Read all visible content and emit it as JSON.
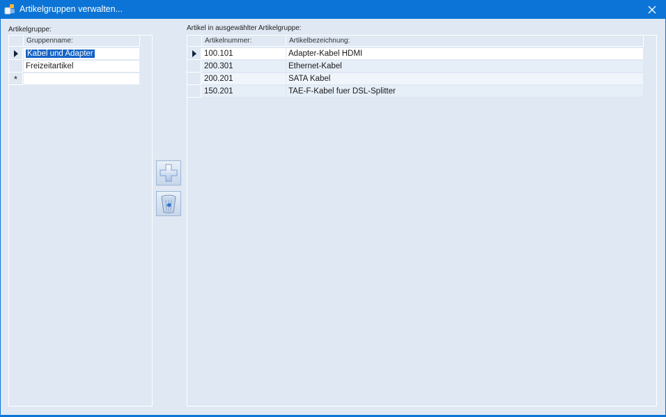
{
  "window": {
    "title": "Artikelgruppen verwalten..."
  },
  "left": {
    "label": "Artikelgruppe:",
    "column": "Gruppenname:",
    "rows": [
      "Kabel und Adapter",
      "Freizeitartikel"
    ],
    "new_row_marker": "*"
  },
  "right": {
    "label": "Artikel in ausgewählter Artikelgruppe:",
    "columns": [
      "Artikelnummer:",
      "Artikelbezeichnung:"
    ],
    "rows": [
      [
        "100.101",
        "Adapter-Kabel HDMI"
      ],
      [
        "200.301",
        "Ethernet-Kabel"
      ],
      [
        "200.201",
        "SATA Kabel"
      ],
      [
        "150.201",
        "TAE-F-Kabel fuer DSL-Splitter"
      ]
    ]
  },
  "icons": {
    "add": "plus-icon",
    "delete": "trash-icon",
    "close": "close-icon",
    "app": "app-icon",
    "row_pointer": "row-pointer-icon"
  },
  "colors": {
    "titlebar": "#0b74d6",
    "selection": "#1463c7",
    "background": "#dfe8f3"
  }
}
